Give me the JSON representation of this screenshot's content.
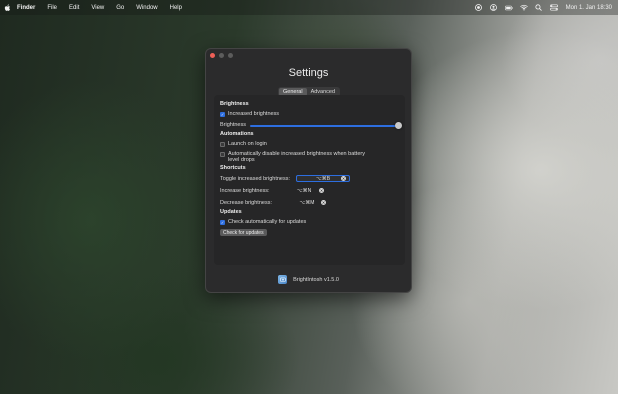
{
  "menubar": {
    "apple_icon": "apple-logo-icon",
    "items": [
      "Finder",
      "File",
      "Edit",
      "View",
      "Go",
      "Window",
      "Help"
    ],
    "status_icons": [
      "record-icon",
      "user-icon",
      "battery-icon",
      "wifi-icon",
      "search-icon",
      "control-center-icon"
    ],
    "clock": "Mon 1. Jan  18:30"
  },
  "window": {
    "title": "Settings",
    "tabs": [
      {
        "label": "General",
        "active": true
      },
      {
        "label": "Advanced",
        "active": false
      }
    ],
    "brightness": {
      "heading": "Brightness",
      "increased_label": "Increased brightness",
      "increased_checked": true,
      "slider_label": "Brightness",
      "slider_value": 1.0
    },
    "automations": {
      "heading": "Automations",
      "launch_label": "Launch on login",
      "launch_checked": false,
      "battery_label_line1": "Automatically disable increased brightness when battery",
      "battery_label_line2": "level drops",
      "battery_checked": false
    },
    "shortcuts": {
      "heading": "Shortcuts",
      "toggle_label": "Toggle increased brightness:",
      "toggle_value": "⌥⌘B",
      "increase_label": "Increase brightness:",
      "increase_value": "⌥⌘N",
      "decrease_label": "Decrease brightness:",
      "decrease_value": "⌥⌘M"
    },
    "updates": {
      "heading": "Updates",
      "auto_label": "Check automatically for updates",
      "auto_checked": true,
      "check_button": "Check for updates"
    },
    "footer": {
      "app_name": "BrightIntosh v1.5.0"
    }
  },
  "colors": {
    "accent": "#2d6ee0",
    "close": "#ee5f57",
    "window_bg": "#2b2b2c",
    "panel_bg": "#262627"
  }
}
